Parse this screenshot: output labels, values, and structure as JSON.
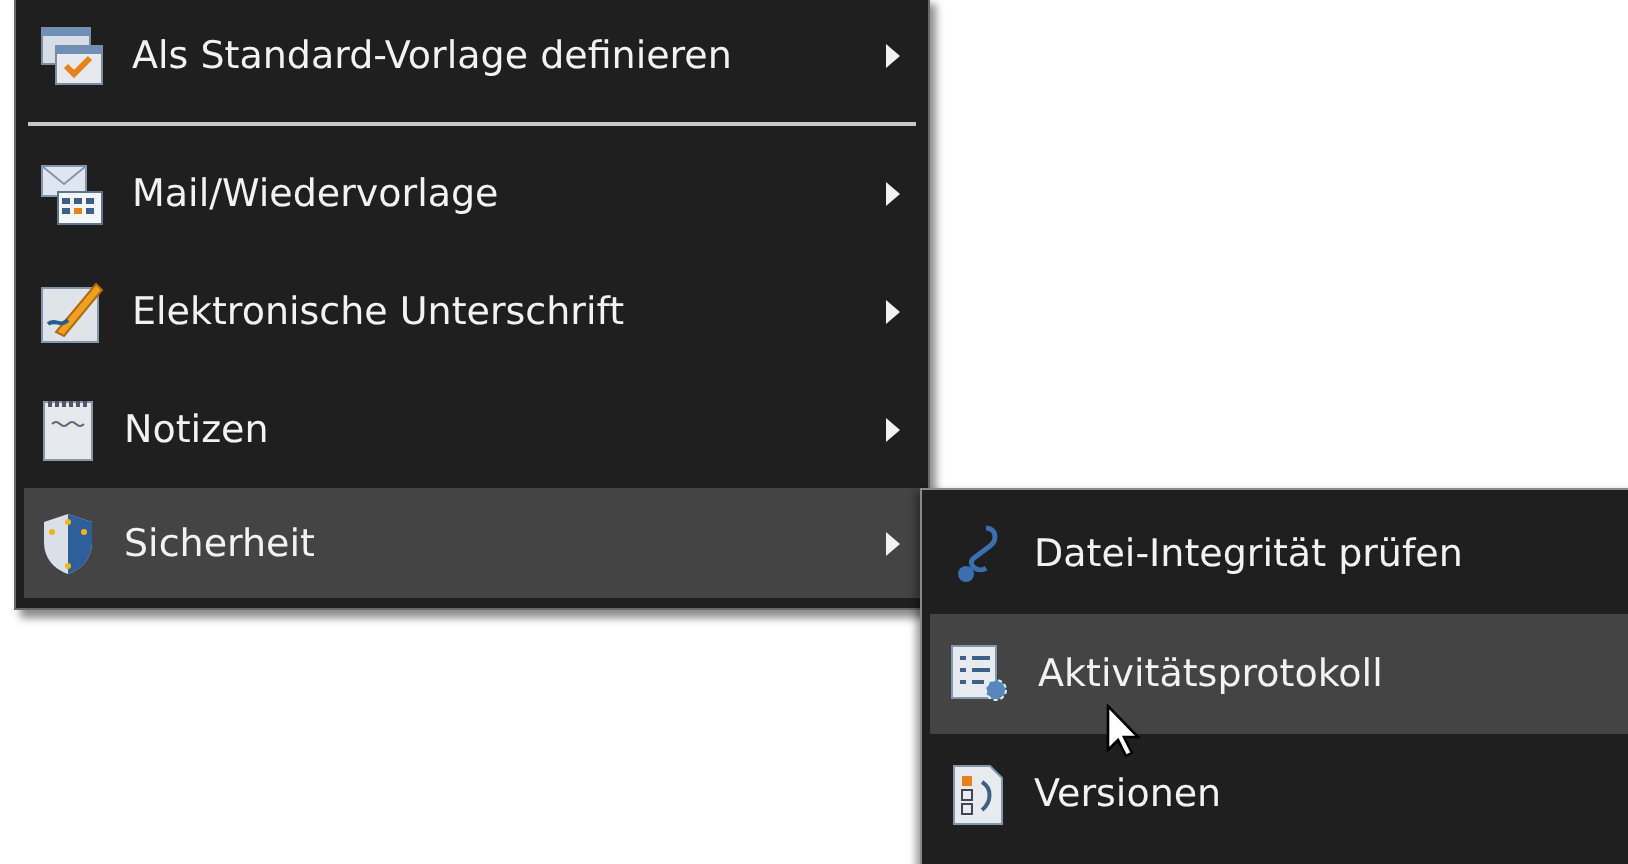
{
  "menu": {
    "items": [
      {
        "label": "Als Standard-Vorlage definieren",
        "selected": false,
        "submenu": true
      },
      {
        "label": "Mail/Wiedervorlage",
        "selected": false,
        "submenu": true
      },
      {
        "label": "Elektronische Unterschrift",
        "selected": false,
        "submenu": true
      },
      {
        "label": "Notizen",
        "selected": false,
        "submenu": true
      },
      {
        "label": "Sicherheit",
        "selected": true,
        "submenu": true
      }
    ]
  },
  "submenu": {
    "items": [
      {
        "label": "Datei-Integrität prüfen",
        "selected": false
      },
      {
        "label": "Aktivitätsprotokoll",
        "selected": true
      },
      {
        "label": "Versionen",
        "selected": false
      }
    ]
  }
}
